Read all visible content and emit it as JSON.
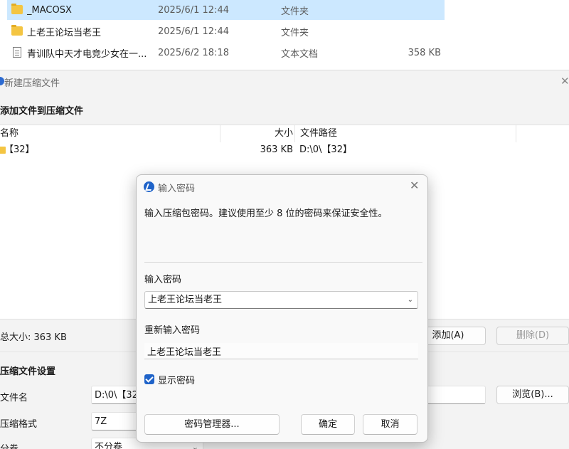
{
  "explorer": {
    "files": [
      {
        "name": "_MACOSX",
        "date": "2025/6/1 12:44",
        "type": "文件夹",
        "size": "",
        "icon": "folder-icon"
      },
      {
        "name": "上老王论坛当老王",
        "date": "2025/6/1 12:44",
        "type": "文件夹",
        "size": "",
        "icon": "folder-icon"
      },
      {
        "name": "青训队中天才电竞少女在一...",
        "date": "2025/6/2 18:18",
        "type": "文本文档",
        "size": "358 KB",
        "icon": "document-icon"
      }
    ]
  },
  "archive_window": {
    "title": "新建压缩文件",
    "heading": "添加文件到压缩文件",
    "columns": {
      "name": "名称",
      "size": "大小",
      "path": "文件路径"
    },
    "items": [
      {
        "name": "【32】",
        "size": "363 KB",
        "path": "D:\\0\\【32】"
      }
    ],
    "total_size": "总大小: 363 KB",
    "add_button": "添加(A)",
    "delete_button": "删除(D)",
    "settings_heading": "压缩文件设置",
    "filename_label": "文件名",
    "filename_value": "D:\\0\\【32",
    "browse_button": "浏览(B)...",
    "format_label": "压缩格式",
    "format_value": "7Z",
    "split_label": "分卷",
    "split_value": "不分卷"
  },
  "password_dialog": {
    "title": "输入密码",
    "message": "输入压缩包密码。建议使用至少 8 位的密码来保证安全性。",
    "password_label": "输入密码",
    "password_value": "上老王论坛当老王",
    "confirm_label": "重新输入密码",
    "confirm_value": "上老王论坛当老王",
    "show_password_label": "显示密码",
    "show_password_checked": true,
    "manager_button": "密码管理器...",
    "ok_button": "确定",
    "cancel_button": "取消"
  },
  "colors": {
    "accent": "#1f63c9",
    "selection": "#cce8ff",
    "folder": "#f4c542"
  }
}
